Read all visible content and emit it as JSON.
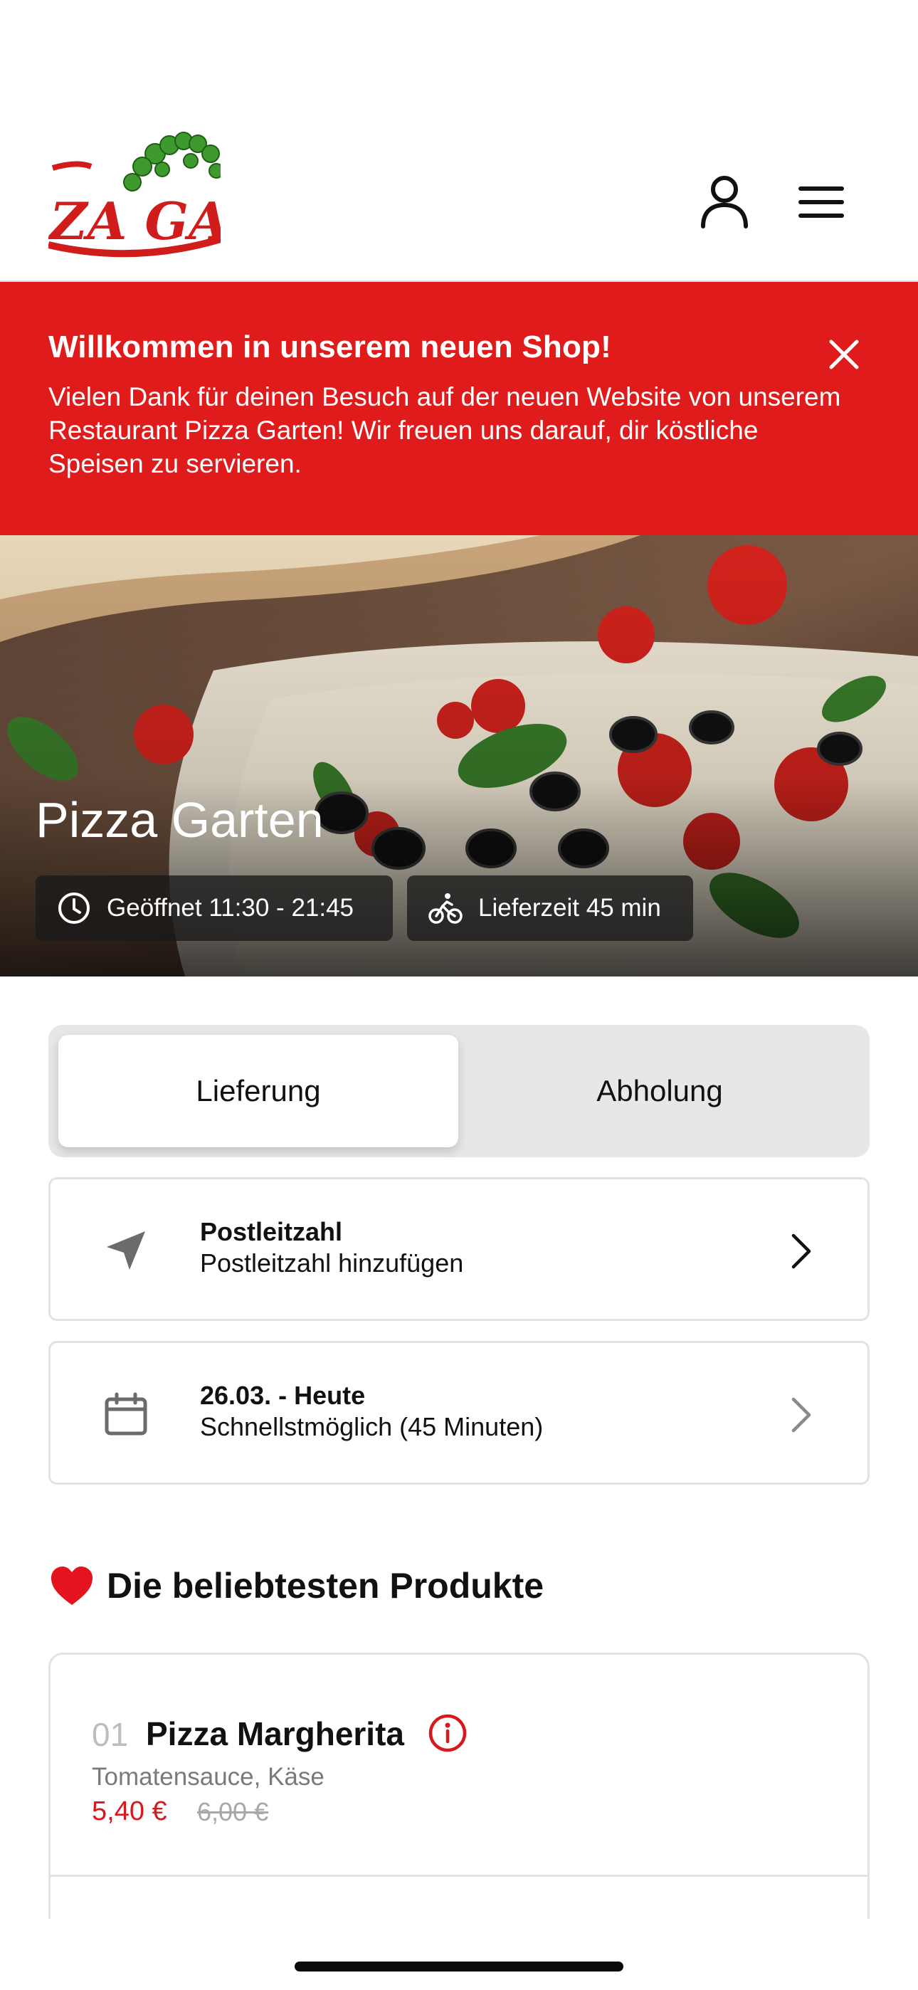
{
  "brand": {
    "logo_text": "ZA GAR",
    "accent": "#e01b1b"
  },
  "header": {
    "profile_icon": "user-icon",
    "menu_icon": "hamburger-menu-icon"
  },
  "banner": {
    "title": "Willkommen in unserem neuen Shop!",
    "text": "Vielen Dank für deinen Besuch auf der neuen Website von unserem Restaurant Pizza Garten! Wir freuen uns darauf, dir köstliche Speisen zu servieren.",
    "close_icon": "close-icon",
    "background": "#e01b1b"
  },
  "hero": {
    "title": "Pizza Garten",
    "opening_hours": "Geöffnet 11:30 - 21:45",
    "delivery_time": "Lieferzeit 45 min"
  },
  "order_mode": {
    "options": [
      "Lieferung",
      "Abholung"
    ],
    "selected": "Lieferung"
  },
  "zip_card": {
    "label": "Postleitzahl",
    "value": "Postleitzahl hinzufügen",
    "icon": "location-arrow-icon"
  },
  "date_card": {
    "label": "26.03. - Heute",
    "value": "Schnellstmöglich (45 Minuten)",
    "icon": "calendar-icon"
  },
  "popular": {
    "title": "Die beliebtesten Produkte",
    "icon": "heart-icon",
    "products": [
      {
        "number": "01",
        "name": "Pizza Margherita",
        "description": "Tomatensauce, Käse",
        "price": "5,40 €",
        "old_price": "6,00 €"
      }
    ]
  }
}
